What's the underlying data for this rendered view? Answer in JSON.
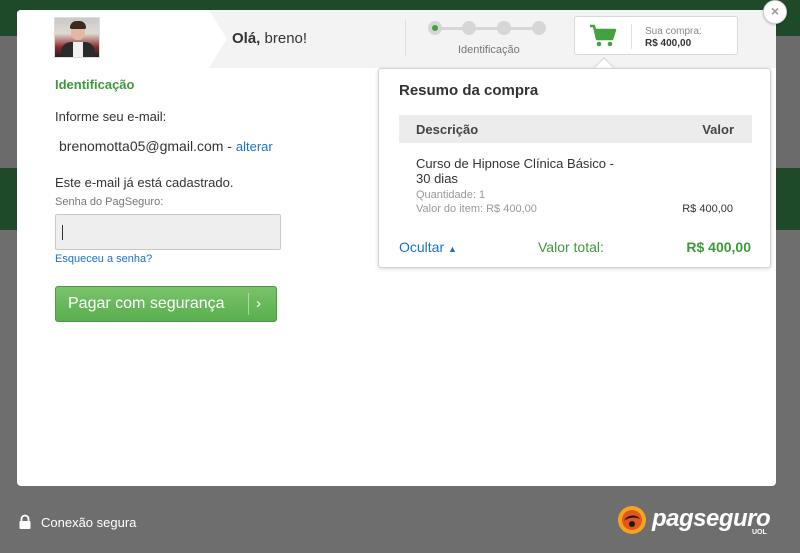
{
  "header": {
    "greeting_prefix": "Olá,",
    "user_name": "breno!",
    "step_label": "Identificação",
    "steps_total": 4,
    "active_step": 1,
    "cart_label": "Sua compra:",
    "cart_value": "R$ 400,00",
    "close_label": "×"
  },
  "form": {
    "section_title": "Identificação",
    "email_prompt": "Informe seu e-mail:",
    "email": "brenomotta05@gmail.com",
    "email_separator": " - ",
    "change_link": "alterar",
    "registered_text": "Este e-mail já está cadastrado.",
    "password_label": "Senha do PagSeguro:",
    "password_value": "",
    "forgot_link": "Esqueceu a senha?",
    "pay_button": "Pagar com segurança",
    "pay_chevron": "›"
  },
  "summary": {
    "title": "Resumo da compra",
    "col_description": "Descrição",
    "col_value": "Valor",
    "item_name": "Curso de Hipnose Clínica Básico - 30 dias",
    "item_quantity": "Quantidade: 1",
    "item_unit": "Valor do item: R$ 400,00",
    "item_price": "R$ 400,00",
    "hide_link": "Ocultar",
    "total_label": "Valor total:",
    "total_value": "R$ 400,00"
  },
  "footer": {
    "secure_text": "Conexão segura",
    "brand": "pagseguro",
    "brand_sub": "UOL"
  },
  "colors": {
    "accent_green": "#3d9a3a",
    "button_green": "#5aae4f",
    "link_blue": "#1a73c8"
  }
}
